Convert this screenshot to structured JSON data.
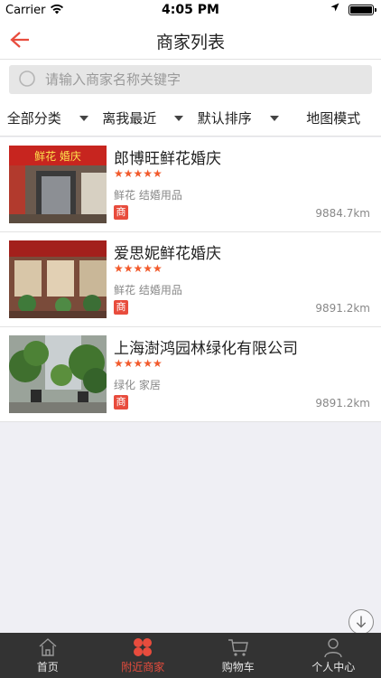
{
  "status": {
    "carrier": "Carrier",
    "time": "4:05 PM"
  },
  "nav": {
    "title": "商家列表"
  },
  "search": {
    "placeholder": "请输入商家名称关键字",
    "value": ""
  },
  "filters": [
    {
      "label": "全部分类"
    },
    {
      "label": "离我最近"
    },
    {
      "label": "默认排序"
    },
    {
      "label": "地图模式"
    }
  ],
  "shops": [
    {
      "name": "郎博旺鲜花婚庆",
      "stars": "★★★★★",
      "rating": 5,
      "tags": "鲜花 结婚用品",
      "badge": "商",
      "distance": "9884.7km",
      "sign_text": "鲜花 婚庆"
    },
    {
      "name": "爱思妮鲜花婚庆",
      "stars": "★★★★★",
      "rating": 5,
      "tags": "鲜花 结婚用品",
      "badge": "商",
      "distance": "9891.2km"
    },
    {
      "name": "上海澍鸿园林绿化有限公司",
      "stars": "★★★★★",
      "rating": 5,
      "tags": "绿化 家居",
      "badge": "商",
      "distance": "9891.2km"
    }
  ],
  "tabs": [
    {
      "label": "首页",
      "icon": "home-icon"
    },
    {
      "label": "附近商家",
      "icon": "nearby-shops-icon",
      "active": true
    },
    {
      "label": "购物车",
      "icon": "cart-icon"
    },
    {
      "label": "个人中心",
      "icon": "user-icon"
    }
  ],
  "colors": {
    "accent": "#e84c3d",
    "tabbar": "#333333"
  }
}
